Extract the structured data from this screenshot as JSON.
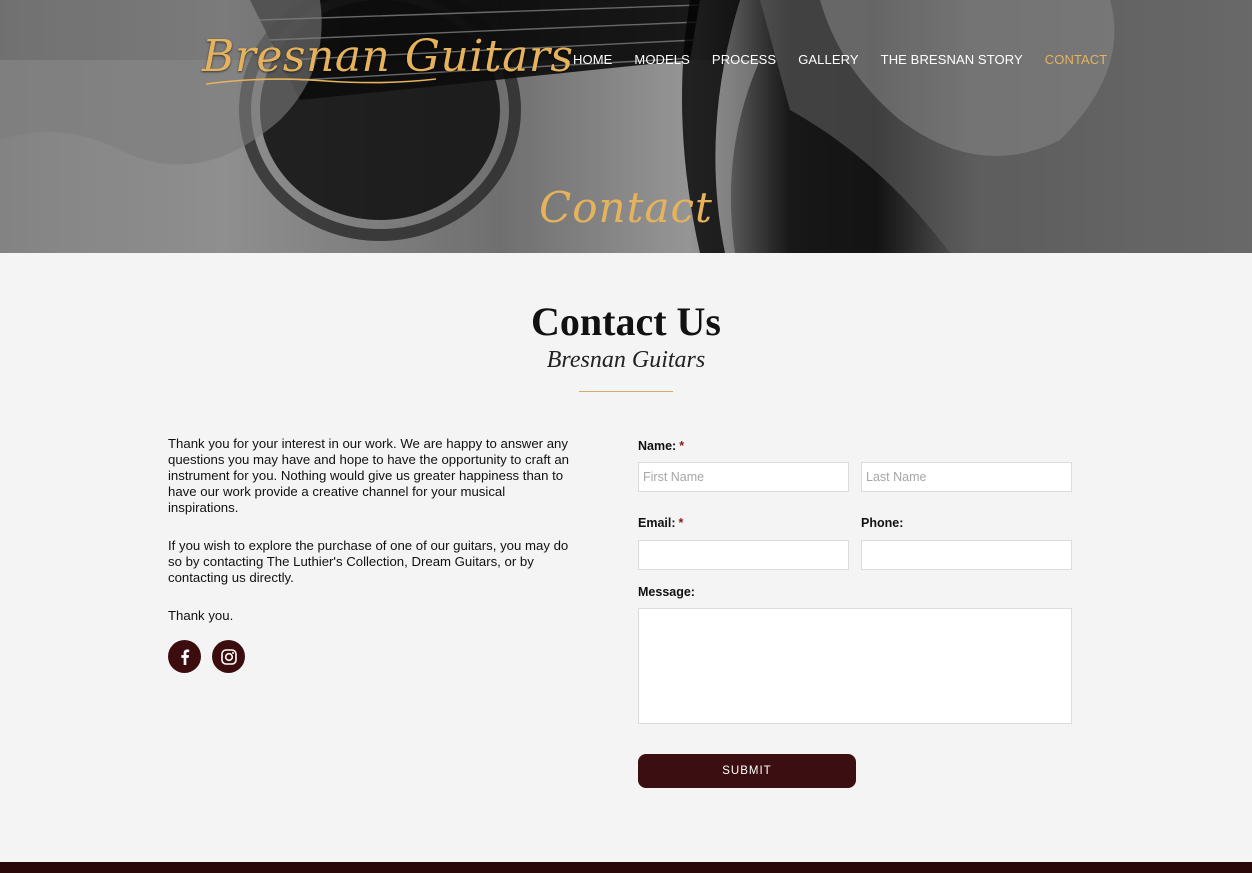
{
  "brand": {
    "logo_text": "Bresnan Guitars"
  },
  "nav": {
    "items": [
      {
        "label": "HOME"
      },
      {
        "label": "MODELS"
      },
      {
        "label": "PROCESS"
      },
      {
        "label": "GALLERY"
      },
      {
        "label": "THE BRESNAN STORY"
      },
      {
        "label": "CONTACT"
      }
    ],
    "active": "CONTACT"
  },
  "hero": {
    "title": "Contact"
  },
  "page": {
    "heading": "Contact Us",
    "subheading": "Bresnan Guitars"
  },
  "intro": {
    "paragraphs": [
      "Thank you for your interest in our work. We are happy to answer any questions you may have and hope to have the opportunity to craft an instrument for you. Nothing would give us greater happiness than to have our work provide a creative channel for your musical inspirations.",
      "If you wish to explore the purchase of one of our guitars, you may do so by contacting The Luthier's Collection, Dream Guitars, or by contacting us directly.",
      "Thank you."
    ]
  },
  "social": {
    "icons": [
      "facebook-icon",
      "instagram-icon"
    ]
  },
  "form": {
    "name_label": "Name:",
    "required_marker": "*",
    "first_name_placeholder": "First Name",
    "last_name_placeholder": "Last Name",
    "email_label": "Email:",
    "phone_label": "Phone:",
    "message_label": "Message:",
    "email_value": "",
    "phone_value": "",
    "message_value": "",
    "submit_label": "SUBMIT"
  },
  "colors": {
    "accent_gold": "#e6b35c",
    "brand_maroon": "#3b0f11",
    "page_background": "#f4f4f4",
    "required_red": "#8a1c1c"
  }
}
